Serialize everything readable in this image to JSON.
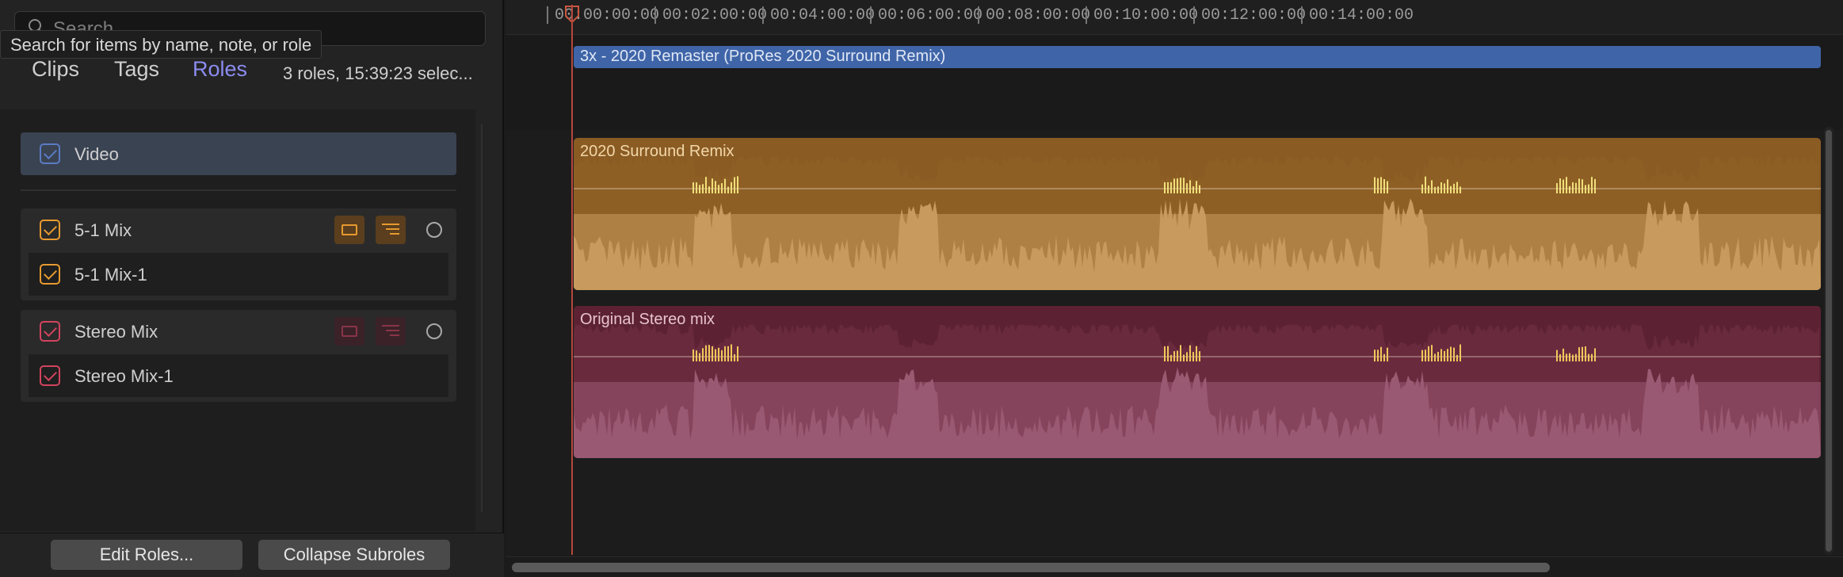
{
  "search": {
    "placeholder": "Search",
    "tooltip": "Search for items by name, note, or role"
  },
  "tabs": {
    "clips": "Clips",
    "tags": "Tags",
    "roles": "Roles",
    "summary": "3 roles, 15:39:23 selec..."
  },
  "roles": {
    "video": {
      "label": "Video",
      "color": "#5a7bc4",
      "checked": true
    },
    "mix51": {
      "label": "5-1 Mix",
      "subrole": "5-1 Mix-1",
      "color": "#e79a2f",
      "checked": true
    },
    "stereo": {
      "label": "Stereo Mix",
      "subrole": "Stereo Mix-1",
      "color": "#d2445e",
      "checked": true
    }
  },
  "buttons": {
    "edit_roles": "Edit Roles...",
    "collapse_subroles": "Collapse Subroles"
  },
  "ruler": {
    "labels": [
      "00:00:00:00",
      "00:02:00:00",
      "00:04:00:00",
      "00:06:00:00",
      "00:08:00:00",
      "00:10:00:00",
      "00:12:00:00",
      "00:14:00:00"
    ]
  },
  "clips": {
    "video": {
      "label": "3x - 2020 Remaster (ProRes 2020 Surround Remix)",
      "color": "#3f65a8"
    },
    "surround": {
      "label": "2020 Surround Remix",
      "color": "#8a5c24",
      "wave_light": "#c99a5e",
      "wave_dark": "#8e5f25"
    },
    "stereo": {
      "label": "Original Stereo mix",
      "color": "#5c2234",
      "wave_light": "#9a5a72",
      "wave_dark": "#6a2a3e"
    }
  },
  "icons": {
    "search": "search-icon",
    "lane_toggle": "lane-toggle-icon",
    "subrole_lanes": "subrole-lanes-icon",
    "focus": "focus-circle-icon",
    "playhead": "playhead-icon"
  }
}
